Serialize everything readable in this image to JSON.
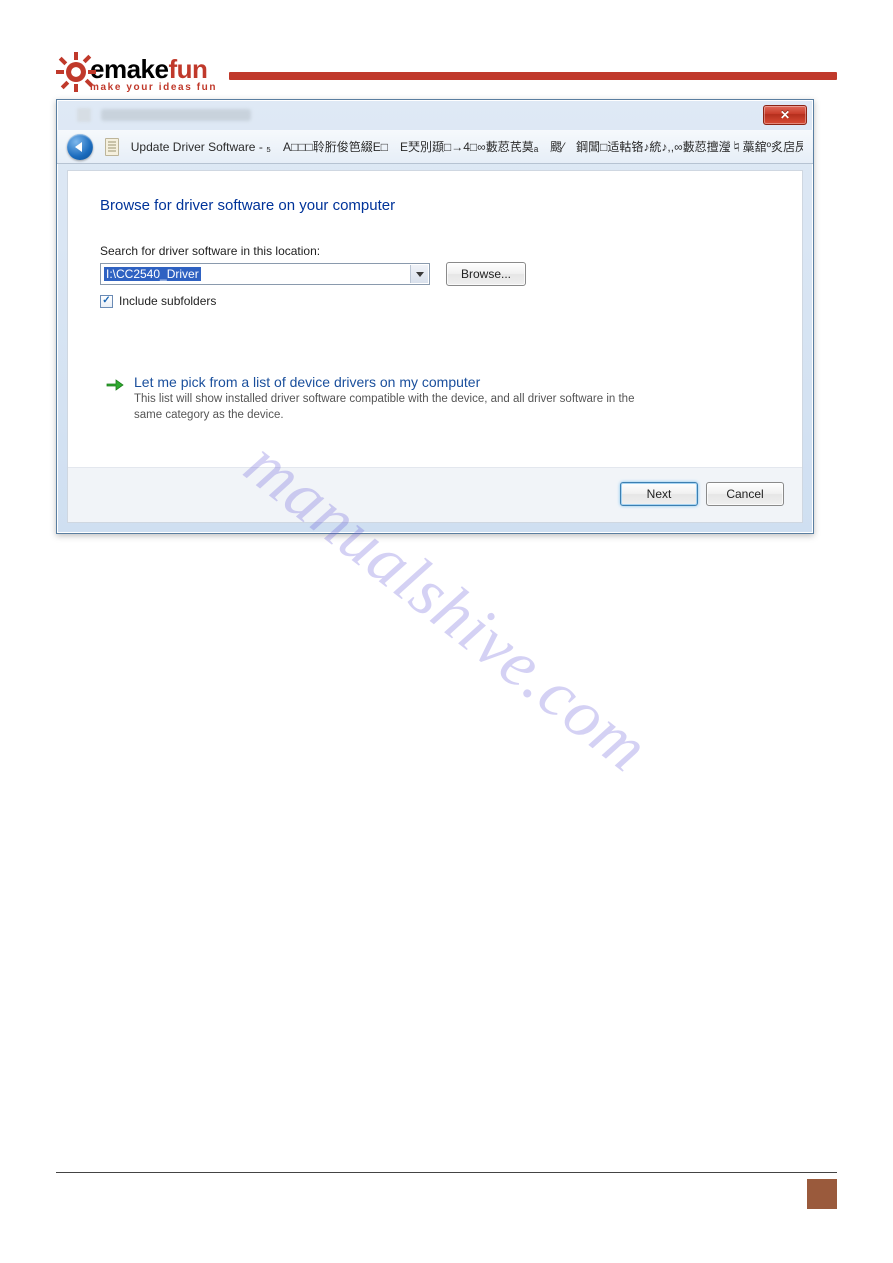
{
  "logo": {
    "main_left": "emake",
    "main_right": "fun",
    "tagline": "make your ideas fun"
  },
  "window": {
    "nav_text": "Update Driver Software - ₅　A□□□聆胻俊笆綴E□　E珡別頲□→4□∞藪荵芪莫ₐ　颸⁄　鋼閶□适軲铬♪統♪,,∞藪荵擅瀅♮藁舘º炙扂昃"
  },
  "dialog": {
    "heading": "Browse for driver software on your computer",
    "search_label": "Search for driver software in this location:",
    "path_value": "I:\\CC2540_Driver",
    "browse_label": "Browse...",
    "include_subfolders": "Include subfolders",
    "link_title": "Let me pick from a list of device drivers on my computer",
    "link_desc": "This list will show installed driver software compatible with the device, and all driver software in the same category as the device.",
    "next_label": "Next",
    "cancel_label": "Cancel"
  },
  "watermark": "manualshive.com"
}
